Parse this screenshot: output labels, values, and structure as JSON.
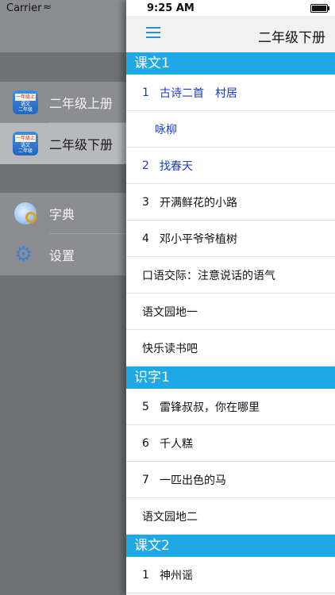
{
  "status": {
    "carrier": "Carrier",
    "time": "9:25 AM"
  },
  "header": {
    "title": "二年级下册"
  },
  "sidebar": {
    "books": [
      {
        "label": "二年级上册",
        "icon": "textbook-icon",
        "cover_band": "一年级上",
        "cover_text": "语文\n二年级",
        "selected": false
      },
      {
        "label": "二年级下册",
        "icon": "textbook-icon",
        "cover_band": "一年级上",
        "cover_text": "语文\n二年级",
        "selected": true
      }
    ],
    "tools": [
      {
        "label": "字典",
        "icon": "dictionary-icon"
      },
      {
        "label": "设置",
        "icon": "gear-icon"
      }
    ]
  },
  "sections": [
    {
      "title": "课文1",
      "rows": [
        {
          "num": "1",
          "title": "古诗二首　村居",
          "blue": true
        },
        {
          "num": "",
          "title": "咏柳",
          "blue": true,
          "indent": true
        },
        {
          "num": "2",
          "title": "找春天",
          "blue": true
        },
        {
          "num": "3",
          "title": "开满鲜花的小路"
        },
        {
          "num": "4",
          "title": "邓小平爷爷植树"
        },
        {
          "num": "",
          "title": "口语交际：注意说话的语气"
        },
        {
          "num": "",
          "title": "语文园地一"
        },
        {
          "num": "",
          "title": "快乐读书吧"
        }
      ]
    },
    {
      "title": "识字1",
      "rows": [
        {
          "num": "5",
          "title": "雷锋叔叔，你在哪里"
        },
        {
          "num": "6",
          "title": "千人糕"
        },
        {
          "num": "7",
          "title": "一匹出色的马"
        },
        {
          "num": "",
          "title": "语文园地二"
        }
      ]
    },
    {
      "title": "课文2",
      "rows": [
        {
          "num": "1",
          "title": "神州谣"
        }
      ]
    }
  ]
}
